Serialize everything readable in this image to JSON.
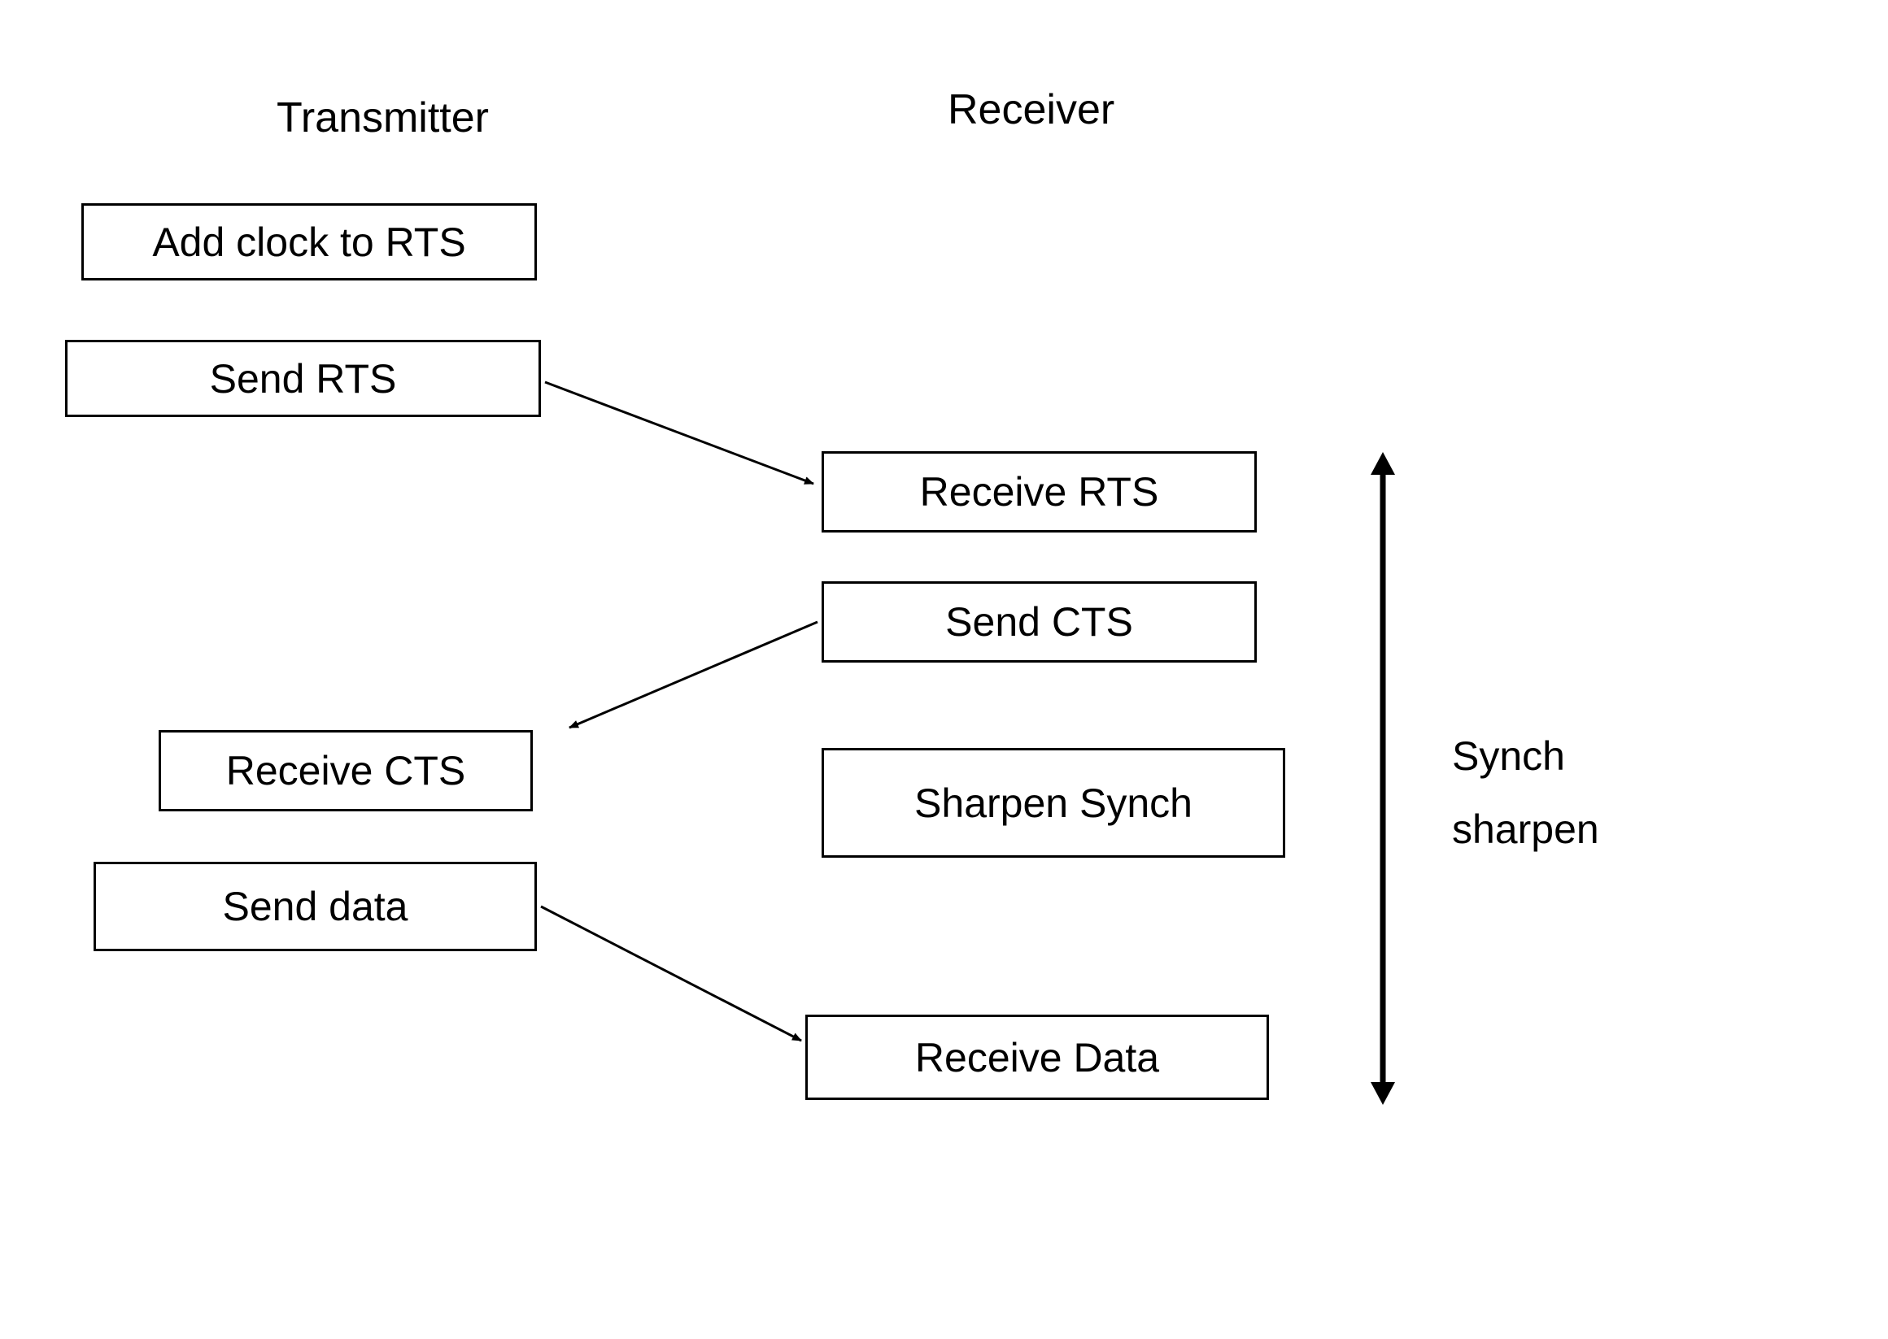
{
  "headers": {
    "transmitter": "Transmitter",
    "receiver": "Receiver"
  },
  "transmitter_boxes": {
    "add_clock": "Add clock to RTS",
    "send_rts": "Send RTS",
    "receive_cts": "Receive CTS",
    "send_data": "Send data"
  },
  "receiver_boxes": {
    "receive_rts": "Receive RTS",
    "send_cts": "Send CTS",
    "sharpen_synch": "Sharpen Synch",
    "receive_data": "Receive Data"
  },
  "annotation": {
    "line1": "Synch",
    "line2": "sharpen"
  }
}
